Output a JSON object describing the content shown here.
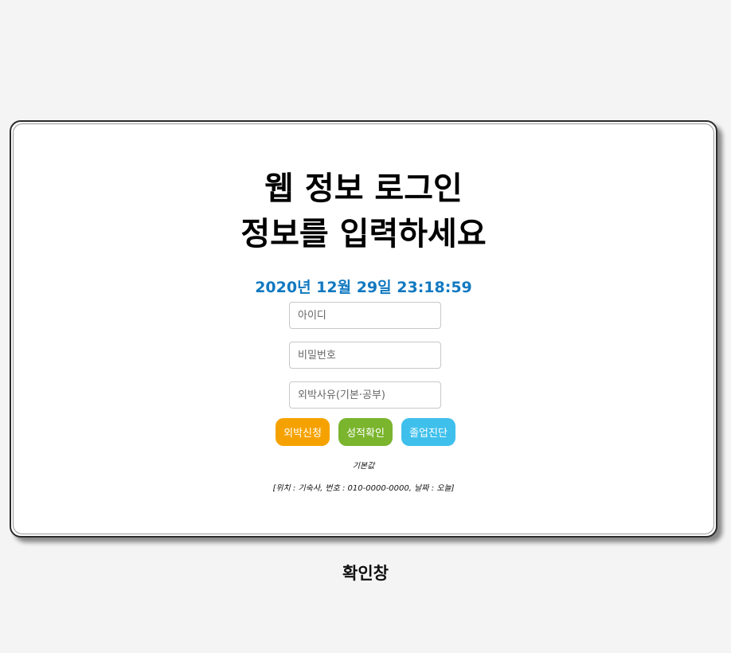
{
  "login": {
    "title_line1": "웹 정보 로그인",
    "title_line2": "정보를 입력하세요",
    "clock": "2020년 12월 29일 23:18:59",
    "id_placeholder": "아이디",
    "password_placeholder": "비밀번호",
    "reason_placeholder": "외박사유(기본·공부)"
  },
  "buttons": {
    "overnight_label": "외박신청",
    "grades_label": "성적확인",
    "graduation_label": "졸업진단"
  },
  "colors": {
    "overnight": "#f5a200",
    "grades": "#7ab52d",
    "graduation": "#3fc0ec",
    "clock": "#1279c1"
  },
  "notes": {
    "default_label": "기본값",
    "default_detail": "[위치 : 기숙사, 번호 : 010-0000-0000, 날짜 : 오늘]"
  },
  "caption": "확인창"
}
